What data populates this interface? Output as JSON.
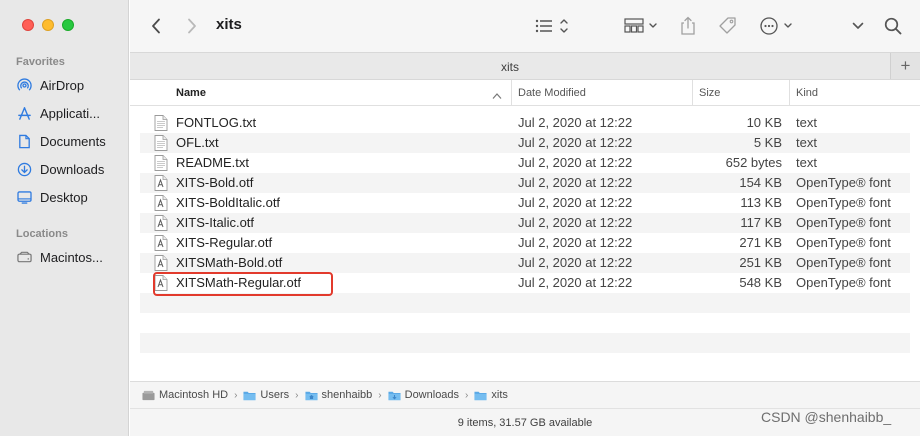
{
  "window": {
    "traffic_lights": [
      "close",
      "minimize",
      "zoom"
    ]
  },
  "sidebar": {
    "favorites_header": "Favorites",
    "favorites": [
      {
        "label": "AirDrop",
        "icon": "airdrop-icon"
      },
      {
        "label": "Applicati...",
        "icon": "applications-icon"
      },
      {
        "label": "Documents",
        "icon": "document-icon"
      },
      {
        "label": "Downloads",
        "icon": "download-icon"
      },
      {
        "label": "Desktop",
        "icon": "desktop-icon"
      }
    ],
    "locations_header": "Locations",
    "locations": [
      {
        "label": "Macintos...",
        "icon": "disk-icon"
      }
    ]
  },
  "toolbar": {
    "title": "xits"
  },
  "tabbar": {
    "tab_label": "xits",
    "add_label": "+"
  },
  "columns": {
    "name": "Name",
    "date": "Date Modified",
    "size": "Size",
    "kind": "Kind"
  },
  "files": [
    {
      "name": "FONTLOG.txt",
      "date": "Jul 2, 2020 at 12:22",
      "size": "10 KB",
      "kind": "text",
      "type": "txt"
    },
    {
      "name": "OFL.txt",
      "date": "Jul 2, 2020 at 12:22",
      "size": "5 KB",
      "kind": "text",
      "type": "txt"
    },
    {
      "name": "README.txt",
      "date": "Jul 2, 2020 at 12:22",
      "size": "652 bytes",
      "kind": "text",
      "type": "txt"
    },
    {
      "name": "XITS-Bold.otf",
      "date": "Jul 2, 2020 at 12:22",
      "size": "154 KB",
      "kind": "OpenType® font",
      "type": "otf"
    },
    {
      "name": "XITS-BoldItalic.otf",
      "date": "Jul 2, 2020 at 12:22",
      "size": "113 KB",
      "kind": "OpenType® font",
      "type": "otf"
    },
    {
      "name": "XITS-Italic.otf",
      "date": "Jul 2, 2020 at 12:22",
      "size": "117 KB",
      "kind": "OpenType® font",
      "type": "otf"
    },
    {
      "name": "XITS-Regular.otf",
      "date": "Jul 2, 2020 at 12:22",
      "size": "271 KB",
      "kind": "OpenType® font",
      "type": "otf"
    },
    {
      "name": "XITSMath-Bold.otf",
      "date": "Jul 2, 2020 at 12:22",
      "size": "251 KB",
      "kind": "OpenType® font",
      "type": "otf"
    },
    {
      "name": "XITSMath-Regular.otf",
      "date": "Jul 2, 2020 at 12:22",
      "size": "548 KB",
      "kind": "OpenType® font",
      "type": "otf"
    }
  ],
  "pathbar": {
    "crumbs": [
      "Macintosh HD",
      "Users",
      "shenhaibb",
      "Downloads",
      "xits"
    ]
  },
  "status": {
    "text": "9 items, 31.57 GB available"
  },
  "watermark": "CSDN @shenhaibb_",
  "colors": {
    "highlight_border": "#e23a2c",
    "folder_blue": "#5aa9e6",
    "sidebar_icon_blue": "#2f7be0"
  }
}
